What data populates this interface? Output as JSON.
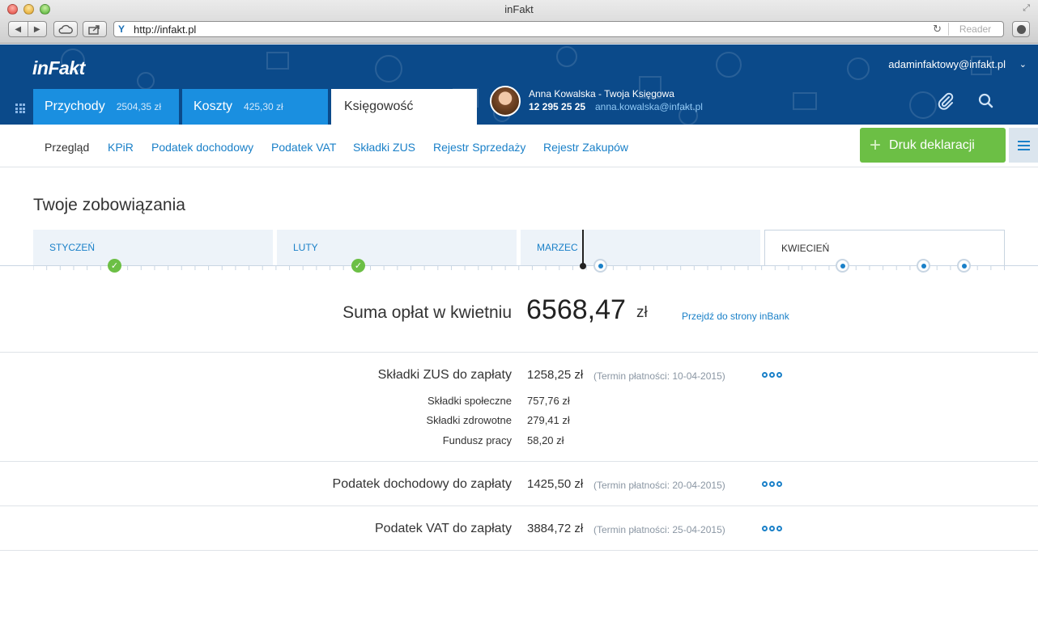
{
  "window": {
    "title": "inFakt",
    "url": "http://infakt.pl",
    "reader_label": "Reader"
  },
  "header": {
    "logo": "inFakt",
    "user_email": "adaminfaktowy@infakt.pl",
    "tabs": [
      {
        "label": "Przychody",
        "amount": "2504,35 zł"
      },
      {
        "label": "Koszty",
        "amount": "425,30 zł"
      },
      {
        "label": "Księgowość"
      }
    ],
    "accountant": {
      "name": "Anna Kowalska - Twoja Księgowa",
      "phone": "12 295 25 25",
      "email": "anna.kowalska@infakt.pl"
    }
  },
  "subnav": {
    "items": [
      "Przegląd",
      "KPiR",
      "Podatek dochodowy",
      "Podatek VAT",
      "Składki ZUS",
      "Rejestr Sprzedaży",
      "Rejestr Zakupów"
    ],
    "print_button": "Druk deklaracji"
  },
  "content": {
    "title": "Twoje zobowiązania",
    "months": [
      "STYCZEŃ",
      "LUTY",
      "MARZEC",
      "KWIECIEŃ"
    ],
    "sum_label": "Suma opłat w kwietniu",
    "sum_value": "6568,47",
    "sum_currency": "zł",
    "inbank_link": "Przejdź do strony inBank",
    "rows": [
      {
        "label": "Składki ZUS do zapłaty",
        "value": "1258,25 zł",
        "term": "(Termin płatności: 10-04-2015)"
      },
      {
        "label": "Podatek dochodowy do zapłaty",
        "value": "1425,50 zł",
        "term": "(Termin płatności: 20-04-2015)"
      },
      {
        "label": "Podatek VAT do zapłaty",
        "value": "3884,72 zł",
        "term": "(Termin płatności: 25-04-2015)"
      }
    ],
    "zus_breakdown": [
      {
        "label": "Składki społeczne",
        "value": "757,76 zł"
      },
      {
        "label": "Składki zdrowotne",
        "value": "279,41 zł"
      },
      {
        "label": "Fundusz pracy",
        "value": "58,20 zł"
      }
    ]
  },
  "colors": {
    "brand_blue": "#0b4a8a",
    "tab_blue": "#1a8fe0",
    "link_blue": "#1a80c8",
    "green": "#6cbf45"
  }
}
